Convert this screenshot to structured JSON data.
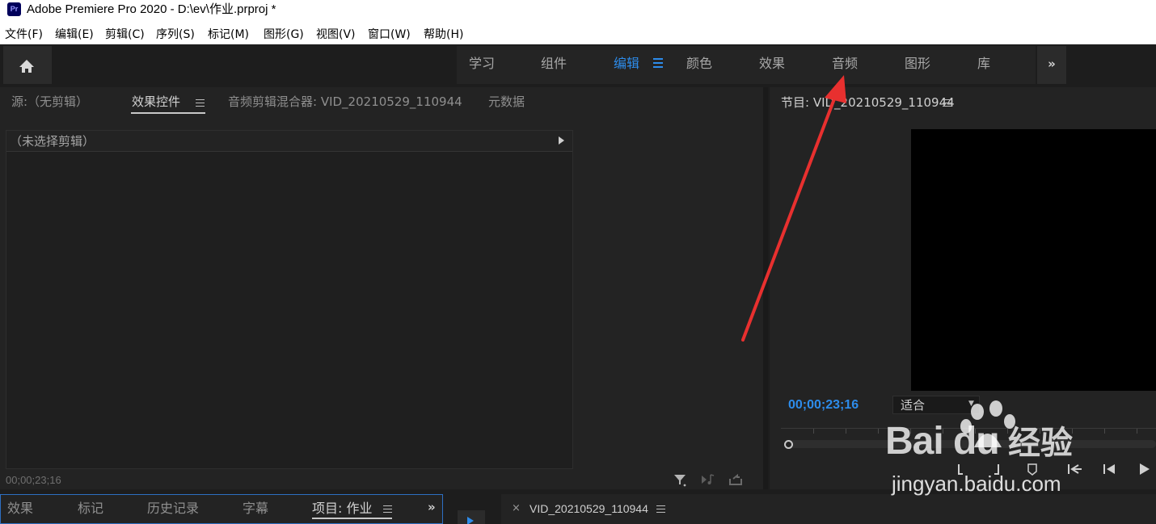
{
  "window": {
    "logo": "Pr",
    "title": "Adobe Premiere Pro 2020 - D:\\ev\\作业.prproj *"
  },
  "menu": [
    "文件(F)",
    "编辑(E)",
    "剪辑(C)",
    "序列(S)",
    "标记(M)",
    "图形(G)",
    "视图(V)",
    "窗口(W)",
    "帮助(H)"
  ],
  "workspaces": {
    "tabs": [
      "学习",
      "组件",
      "编辑",
      "颜色",
      "效果",
      "音频",
      "图形",
      "库"
    ],
    "active": "编辑",
    "more": "»"
  },
  "source_panel": {
    "tabs": [
      "源:（无剪辑）",
      "效果控件",
      "音频剪辑混合器: VID_20210529_110944",
      "元数据"
    ],
    "active_tab": "效果控件",
    "no_clip_text": "（未选择剪辑）",
    "timecode": "00;00;23;16"
  },
  "program_monitor": {
    "title": "节目: VID_20210529_110944",
    "timecode": "00;00;23;16",
    "zoom_option": "适合"
  },
  "bottom_left_panel": {
    "tabs": [
      "效果",
      "标记",
      "历史记录",
      "字幕",
      "项目: 作业"
    ],
    "active_tab": "项目: 作业",
    "more": "»"
  },
  "timeline": {
    "close": "×",
    "sequence_tab": "VID_20210529_110944"
  },
  "watermark": {
    "brand": "Bai du",
    "product": "经验",
    "url": "jingyan.baidu.com"
  },
  "colors": {
    "accent": "#2d8ceb",
    "annotation_arrow": "#e8302f",
    "panel_bg": "#232323"
  }
}
